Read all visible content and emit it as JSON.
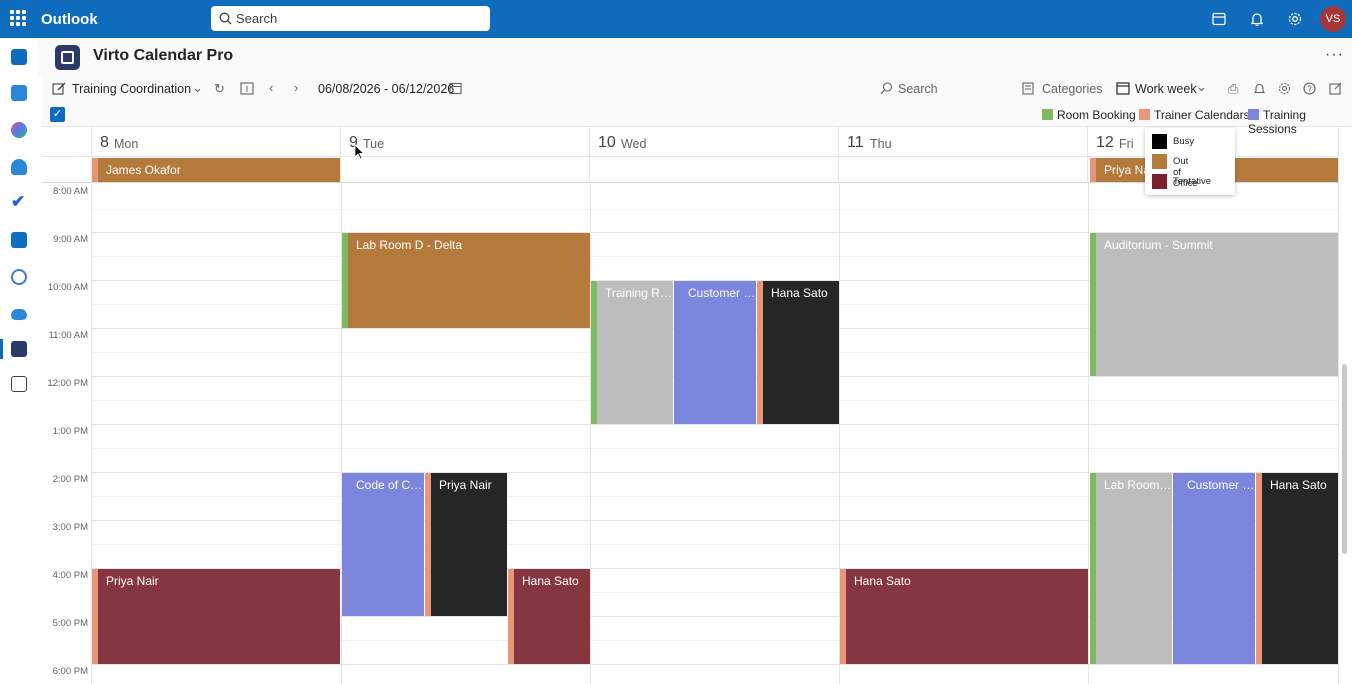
{
  "topbar": {
    "app_name": "Outlook",
    "search_placeholder": "Search",
    "avatar_initials": "VS"
  },
  "app": {
    "title": "Virto Calendar Pro"
  },
  "toolbar": {
    "view_name": "Training Coordination",
    "date_range": "06/08/2026 - 06/12/2026",
    "search_label": "Search",
    "categories_label": "Categories",
    "view_mode": "Work week"
  },
  "legend": {
    "items": [
      {
        "label": "Room Booking",
        "color": "#7fb961"
      },
      {
        "label": "Trainer Calendars",
        "color": "#e8957a"
      },
      {
        "label": "Training Sessions",
        "color": "#7b86dc"
      }
    ]
  },
  "days": [
    {
      "num": "8",
      "name": "Mon"
    },
    {
      "num": "9",
      "name": "Tue"
    },
    {
      "num": "10",
      "name": "Wed"
    },
    {
      "num": "11",
      "name": "Thu"
    },
    {
      "num": "12",
      "name": "Fri"
    }
  ],
  "times": [
    "8:00 AM",
    "9:00 AM",
    "10:00 AM",
    "11:00 AM",
    "12:00 PM",
    "1:00 PM",
    "2:00 PM",
    "3:00 PM",
    "4:00 PM",
    "5:00 PM",
    "6:00 PM"
  ],
  "allday_events": [
    {
      "title": "James Okafor"
    },
    {
      "title": "Priya Nair"
    }
  ],
  "events": {
    "tue_lab_room": "Lab Room D - Delta",
    "wed_training_room": "Training Roo...",
    "wed_customer": "Customer S...",
    "wed_hana": "Hana Sato",
    "fri_auditorium": "Auditorium - Summit",
    "tue_code": "Code of Con...",
    "tue_priya": "Priya Nair",
    "tue_hana": "Hana Sato",
    "mon_priya": "Priya Nair",
    "thu_hana": "Hana Sato",
    "fri_lab": "Lab Room D...",
    "fri_customer": "Customer S...",
    "fri_hana": "Hana Sato"
  },
  "status_popup": {
    "items": [
      {
        "label": "Busy",
        "color": "#000000"
      },
      {
        "label": "Out of Office",
        "color": "#b47a3c"
      },
      {
        "label": "Tentative",
        "color": "#7a1f2b"
      }
    ]
  },
  "colors": {
    "brand": "#0f6cbd",
    "room_booking": "#7fb961",
    "trainer": "#e8957a",
    "training_session": "#7b86dc",
    "busy": "#262626",
    "out_of_office": "#b47a3c",
    "tentative": "#853640",
    "room_gray": "#bdbdbd"
  }
}
